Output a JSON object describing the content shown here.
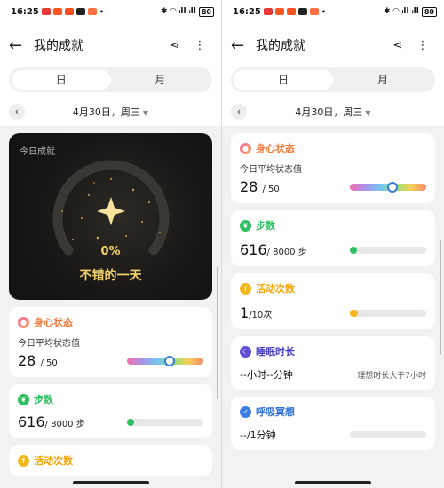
{
  "status": {
    "time": "16:25",
    "battery": "80",
    "signal": "ᵢll ᵢll"
  },
  "header": {
    "title": "我的成就",
    "back_icon": "arrow-left-icon",
    "share_icon": "share-icon",
    "more_icon": "more-vertical-icon"
  },
  "tabs": [
    {
      "label": "日",
      "active": true
    },
    {
      "label": "月",
      "active": false
    }
  ],
  "date": {
    "label": "4月30日，周三"
  },
  "hero": {
    "label": "今日成就",
    "percent": "0%",
    "message": "不错的一天",
    "progress": 0
  },
  "cards": {
    "mind": {
      "title": "身心状态",
      "sub": "今日平均状态值",
      "value": "28",
      "unit": "/ 50",
      "level": 0.56,
      "color": "#f07a3c"
    },
    "steps": {
      "title": "步数",
      "value": "616",
      "unit": "/ 8000 步",
      "level": 0.077,
      "color": "#2fbf62",
      "fill_color": "#2fbf62"
    },
    "activity": {
      "title": "活动次数",
      "value": "1",
      "unit": "/10次",
      "level": 0.1,
      "color": "#f5b71e",
      "fill_color": "#f5b71e"
    },
    "sleep": {
      "title": "睡眠时长",
      "value": "--小时--分钟",
      "hint": "理想时长大于7小时",
      "color": "#5b4fd6"
    },
    "meditate": {
      "title": "呼吸冥想",
      "value": "--/1分钟",
      "color": "#3d7ee6"
    }
  },
  "colors": {
    "accent_gold": "#f3d36b",
    "knob_border": "#3b7bd8"
  }
}
